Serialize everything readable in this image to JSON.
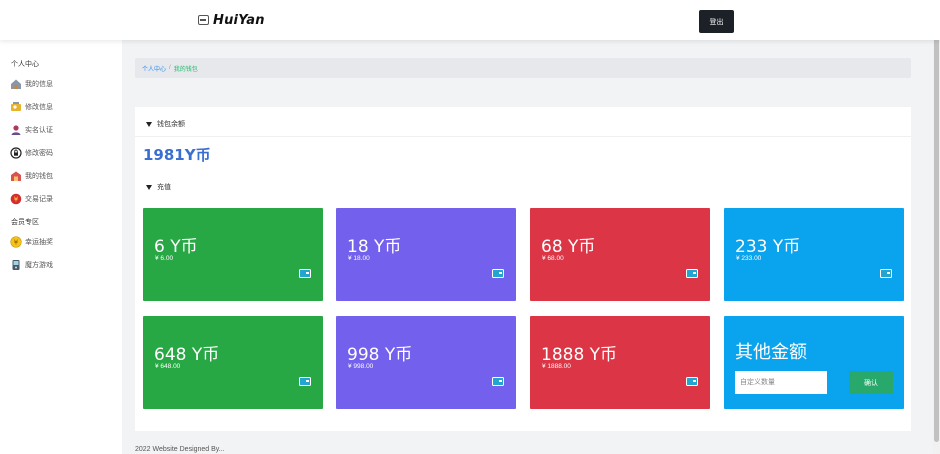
{
  "header": {
    "logo_text": "HuiYan",
    "logout_label": "登出"
  },
  "sidebar": {
    "groups": [
      {
        "title": "个人中心",
        "items": [
          {
            "label": "我的信息",
            "icon": "house-icon"
          },
          {
            "label": "修改信息",
            "icon": "edit-profile-icon"
          },
          {
            "label": "实名认证",
            "icon": "user-id-icon"
          },
          {
            "label": "修改密码",
            "icon": "lock-icon"
          },
          {
            "label": "我的钱包",
            "icon": "wallet-icon"
          },
          {
            "label": "交易记录",
            "icon": "record-icon"
          }
        ]
      },
      {
        "title": "会员专区",
        "items": [
          {
            "label": "幸运抽奖",
            "icon": "lottery-icon"
          },
          {
            "label": "魔方游戏",
            "icon": "game-icon"
          }
        ]
      }
    ]
  },
  "breadcrumb": {
    "parent": "个人中心",
    "separator": "/",
    "current": "我的钱包"
  },
  "wallet": {
    "balance_title": "钱包余额",
    "balance": "1981Y币",
    "recharge_title": "充值"
  },
  "packages": [
    {
      "amount": "6 Y币",
      "price": "¥ 6.00",
      "color": "#28a745"
    },
    {
      "amount": "18 Y币",
      "price": "¥ 18.00",
      "color": "#7360ec"
    },
    {
      "amount": "68 Y币",
      "price": "¥ 68.00",
      "color": "#dc3545"
    },
    {
      "amount": "233 Y币",
      "price": "¥ 233.00",
      "color": "#0aa3ee"
    },
    {
      "amount": "648 Y币",
      "price": "¥ 648.00",
      "color": "#28a745"
    },
    {
      "amount": "998 Y币",
      "price": "¥ 998.00",
      "color": "#7360ec"
    },
    {
      "amount": "1888 Y币",
      "price": "¥ 1888.00",
      "color": "#dc3545"
    }
  ],
  "custom": {
    "title": "其他金额",
    "placeholder": "自定义数量",
    "value": "",
    "confirm_label": "确认",
    "color": "#0aa3ee"
  },
  "footer": {
    "text": "2022 Website Designed By..."
  }
}
